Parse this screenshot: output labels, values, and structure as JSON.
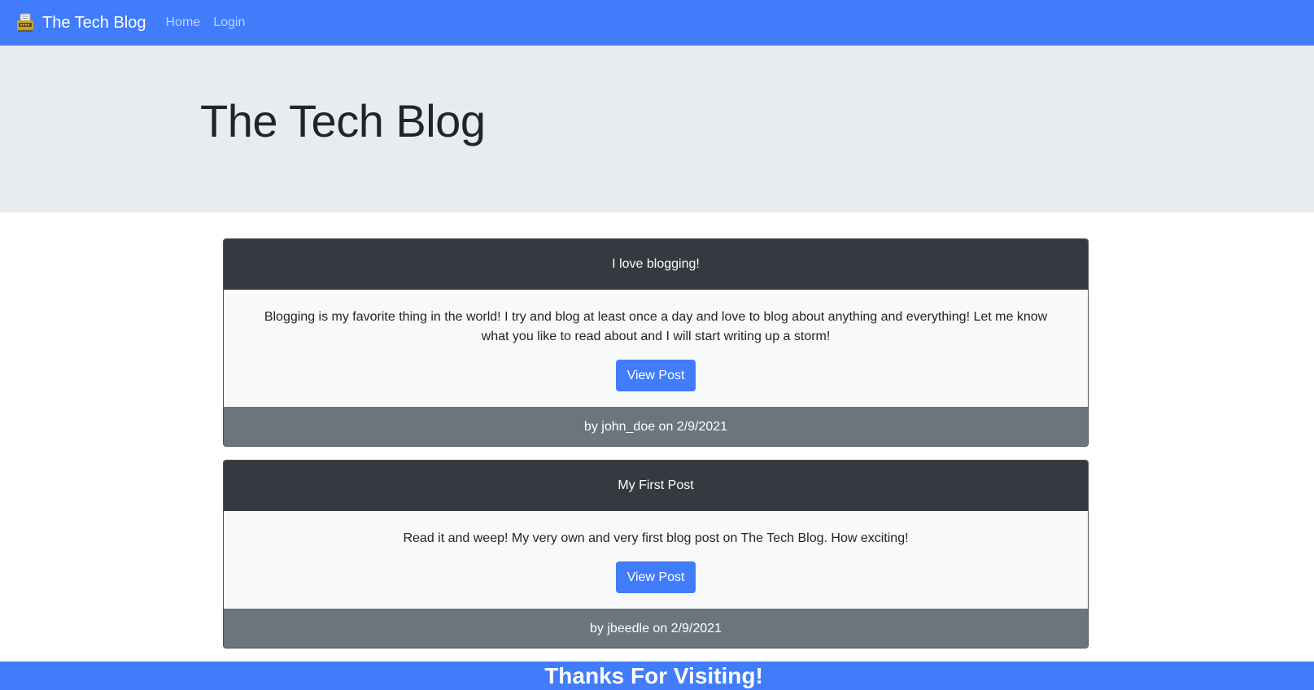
{
  "navbar": {
    "brand": "The Tech Blog",
    "brand_icon": "typewriter-icon",
    "links": [
      "Home",
      "Login"
    ]
  },
  "jumbotron": {
    "title": "The Tech Blog"
  },
  "posts": [
    {
      "title": "I love blogging!",
      "content": "Blogging is my favorite thing in the world! I try and blog at least once a day and love to blog about anything and everything! Let me know what you like to read about and I will start writing up a storm!",
      "button": "View Post",
      "byline": "by john_doe on 2/9/2021"
    },
    {
      "title": "My First Post",
      "content": "Read it and weep! My very own and very first blog post on The Tech Blog. How exciting!",
      "button": "View Post",
      "byline": "by jbeedle on 2/9/2021"
    }
  ],
  "footer": {
    "text": "Thanks For Visiting!"
  },
  "colors": {
    "primary": "#417cfb",
    "jumbotron_bg": "#e9ecef",
    "card_header": "#343a40",
    "card_footer": "#6c757d",
    "card_body": "#f8f9fa"
  }
}
